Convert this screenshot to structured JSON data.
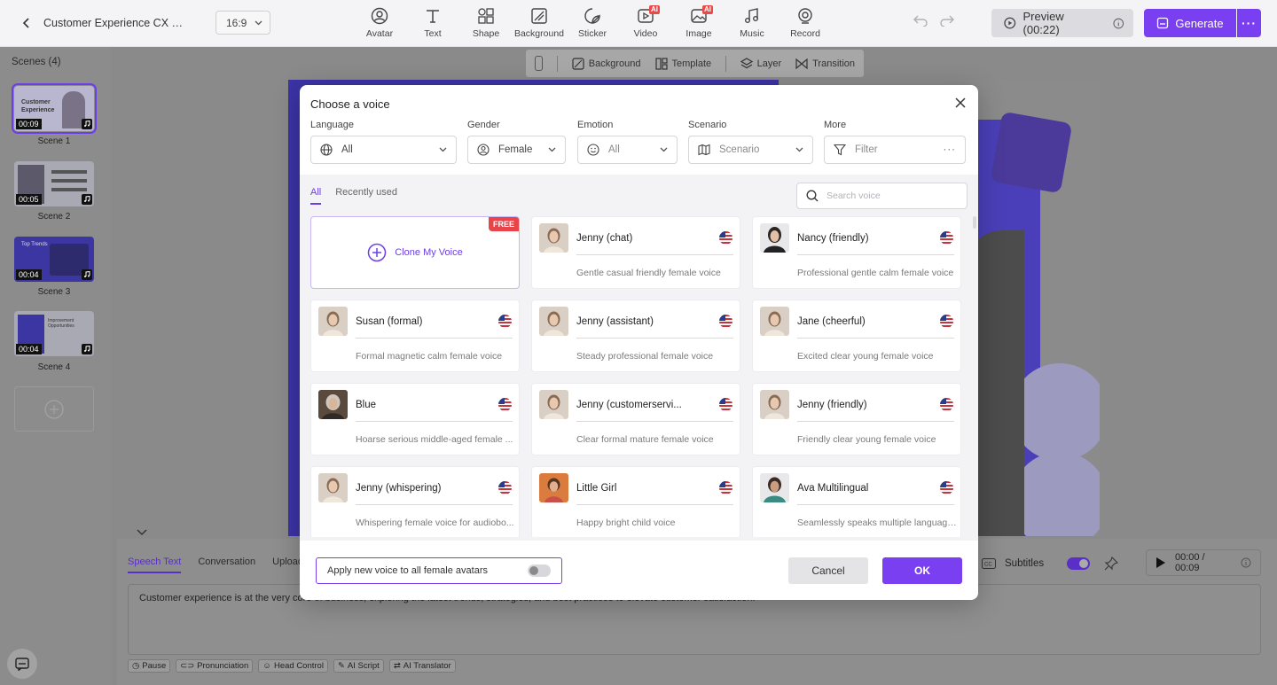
{
  "header": {
    "project_title": "Customer Experience CX Bri...",
    "aspect_ratio": "16:9",
    "tools": [
      {
        "label": "Avatar",
        "icon": "avatar-icon",
        "ai": false
      },
      {
        "label": "Text",
        "icon": "text-icon",
        "ai": false
      },
      {
        "label": "Shape",
        "icon": "shape-icon",
        "ai": false
      },
      {
        "label": "Background",
        "icon": "background-icon",
        "ai": false
      },
      {
        "label": "Sticker",
        "icon": "sticker-icon",
        "ai": false
      },
      {
        "label": "Video",
        "icon": "video-icon",
        "ai": true
      },
      {
        "label": "Image",
        "icon": "image-icon",
        "ai": true
      },
      {
        "label": "Music",
        "icon": "music-icon",
        "ai": false
      },
      {
        "label": "Record",
        "icon": "record-icon",
        "ai": false
      }
    ],
    "ai_badge": "AI",
    "preview_label": "Preview (00:22)",
    "generate_label": "Generate",
    "accent_color": "#7b3ff2"
  },
  "scenes": {
    "heading": "Scenes (4)",
    "items": [
      {
        "label": "Scene 1",
        "time": "00:09",
        "slide_title": "Customer Experience"
      },
      {
        "label": "Scene 2",
        "time": "00:05"
      },
      {
        "label": "Scene 3",
        "time": "00:04",
        "slide_title": "Top Trends"
      },
      {
        "label": "Scene 4",
        "time": "00:04",
        "slide_title": "Improvement Opportunities"
      }
    ]
  },
  "canvas_toolbar": {
    "background": "Background",
    "template": "Template",
    "layer": "Layer",
    "transition": "Transition"
  },
  "bottom_panel": {
    "tabs": [
      "Speech Text",
      "Conversation",
      "Upload"
    ],
    "speech_text": "Customer experience is at the very core of business, exploring the latest trends, strategies, and best practices to elevate customer satisfaction.",
    "subtitles_label": "Subtitles",
    "time": "00:00 / 00:09",
    "chips": [
      "Pause",
      "Pronunciation",
      "Head Control",
      "AI Script",
      "AI Translator"
    ]
  },
  "modal": {
    "title": "Choose a voice",
    "filters": [
      {
        "label": "Language",
        "value": "All",
        "icon": "globe-icon"
      },
      {
        "label": "Gender",
        "value": "Female",
        "icon": "person-icon"
      },
      {
        "label": "Emotion",
        "value": "All",
        "icon": "smile-icon"
      },
      {
        "label": "Scenario",
        "value": "Scenario",
        "icon": "map-icon"
      },
      {
        "label": "More",
        "value": "Filter",
        "icon": "filter-icon"
      }
    ],
    "tabs": [
      "All",
      "Recently used"
    ],
    "search_placeholder": "Search voice",
    "clone_label": "Clone My Voice",
    "free_badge": "FREE",
    "voices": [
      {
        "name": "Jenny (chat)",
        "desc": "Gentle casual friendly female voice"
      },
      {
        "name": "Nancy (friendly)",
        "desc": "Professional gentle calm female voice"
      },
      {
        "name": "Susan (formal)",
        "desc": "Formal magnetic calm female voice"
      },
      {
        "name": "Jenny (assistant)",
        "desc": "Steady professional female voice"
      },
      {
        "name": "Jane (cheerful)",
        "desc": "Excited clear young female voice"
      },
      {
        "name": "Blue",
        "desc": "Hoarse serious middle-aged female ..."
      },
      {
        "name": "Jenny (customerservi...",
        "desc": "Clear formal mature female voice"
      },
      {
        "name": "Jenny (friendly)",
        "desc": "Friendly clear young female voice"
      },
      {
        "name": "Jenny (whispering)",
        "desc": "Whispering female voice for audiobo..."
      },
      {
        "name": "Little Girl",
        "desc": "Happy bright child voice"
      },
      {
        "name": "Ava Multilingual",
        "desc": "Seamlessly speaks multiple languages"
      }
    ],
    "apply_label": "Apply new voice to all female avatars",
    "cancel_label": "Cancel",
    "ok_label": "OK"
  }
}
